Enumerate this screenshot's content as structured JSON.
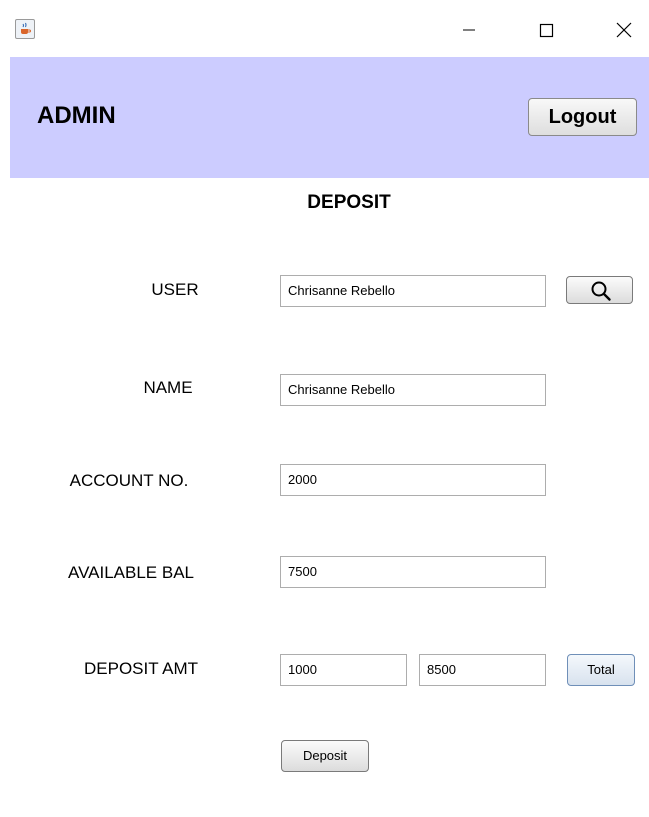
{
  "window": {
    "app_icon": "java-coffee-cup-icon",
    "controls": [
      "minimize-icon",
      "maximize-icon",
      "close-icon"
    ]
  },
  "header": {
    "title": "ADMIN",
    "logout_label": "Logout",
    "background_color": "#ccccff"
  },
  "form": {
    "title": "DEPOSIT",
    "user": {
      "label": "USER",
      "value": "Chrisanne Rebello",
      "search_icon": "magnifier-icon"
    },
    "name": {
      "label": "NAME",
      "value": "Chrisanne Rebello"
    },
    "account": {
      "label": "ACCOUNT NO.",
      "value": "2000"
    },
    "balance": {
      "label": "AVAILABLE BAL",
      "value": "7500"
    },
    "deposit_amt": {
      "label": "DEPOSIT AMT",
      "value": "1000",
      "total_value": "8500",
      "total_label": "Total"
    },
    "deposit_label": "Deposit"
  }
}
